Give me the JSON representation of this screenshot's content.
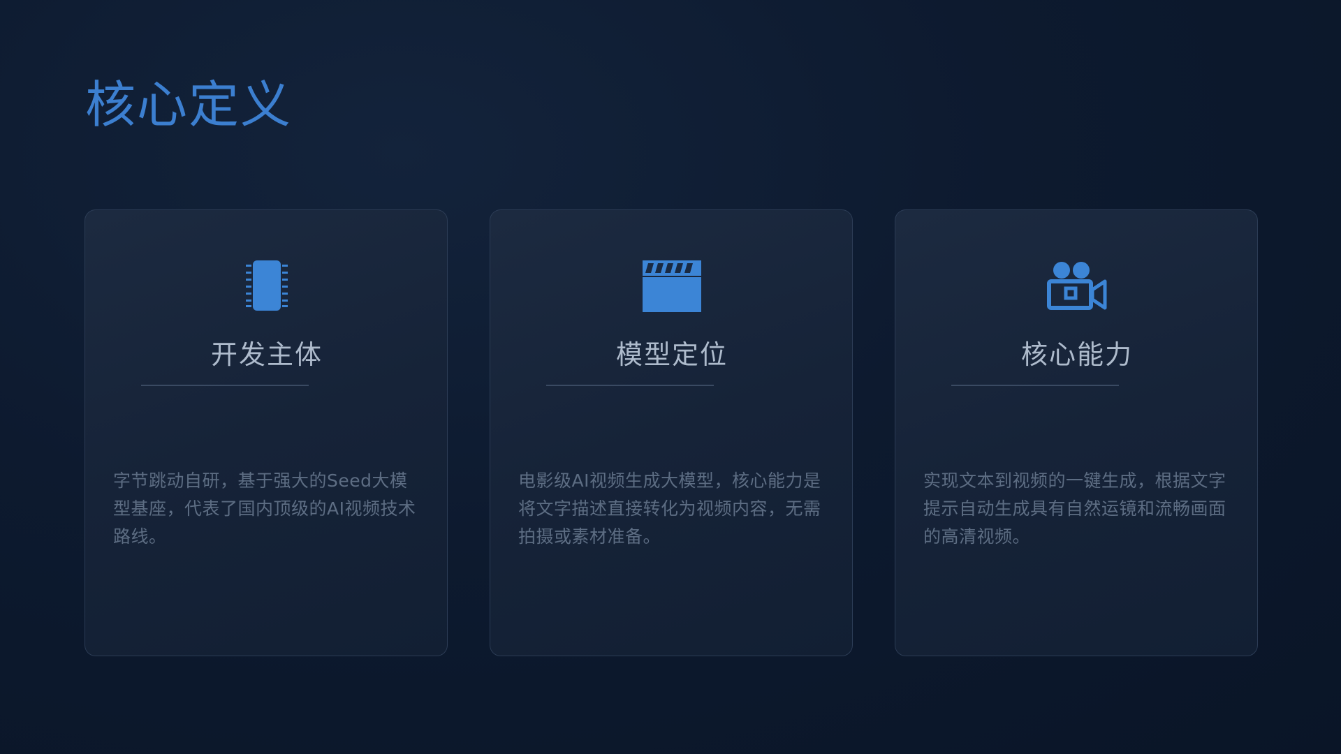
{
  "page": {
    "title": "核心定义"
  },
  "cards": [
    {
      "icon": "chip-icon",
      "title": "开发主体",
      "description": "字节跳动自研，基于强大的Seed大模型基座，代表了国内顶级的AI视频技术路线。"
    },
    {
      "icon": "clapperboard-icon",
      "title": "模型定位",
      "description": "电影级AI视频生成大模型，核心能力是将文字描述直接转化为视频内容，无需拍摄或素材准备。"
    },
    {
      "icon": "video-camera-icon",
      "title": "核心能力",
      "description": "实现文本到视频的一键生成，根据文字提示自动生成具有自然运镜和流畅画面的高清视频。"
    }
  ],
  "colors": {
    "accent": "#3c7fd0",
    "background": "#0d1a2f",
    "card_border": "#2c3c55",
    "card_title": "#aebbcc",
    "card_text": "#5d6d83"
  }
}
